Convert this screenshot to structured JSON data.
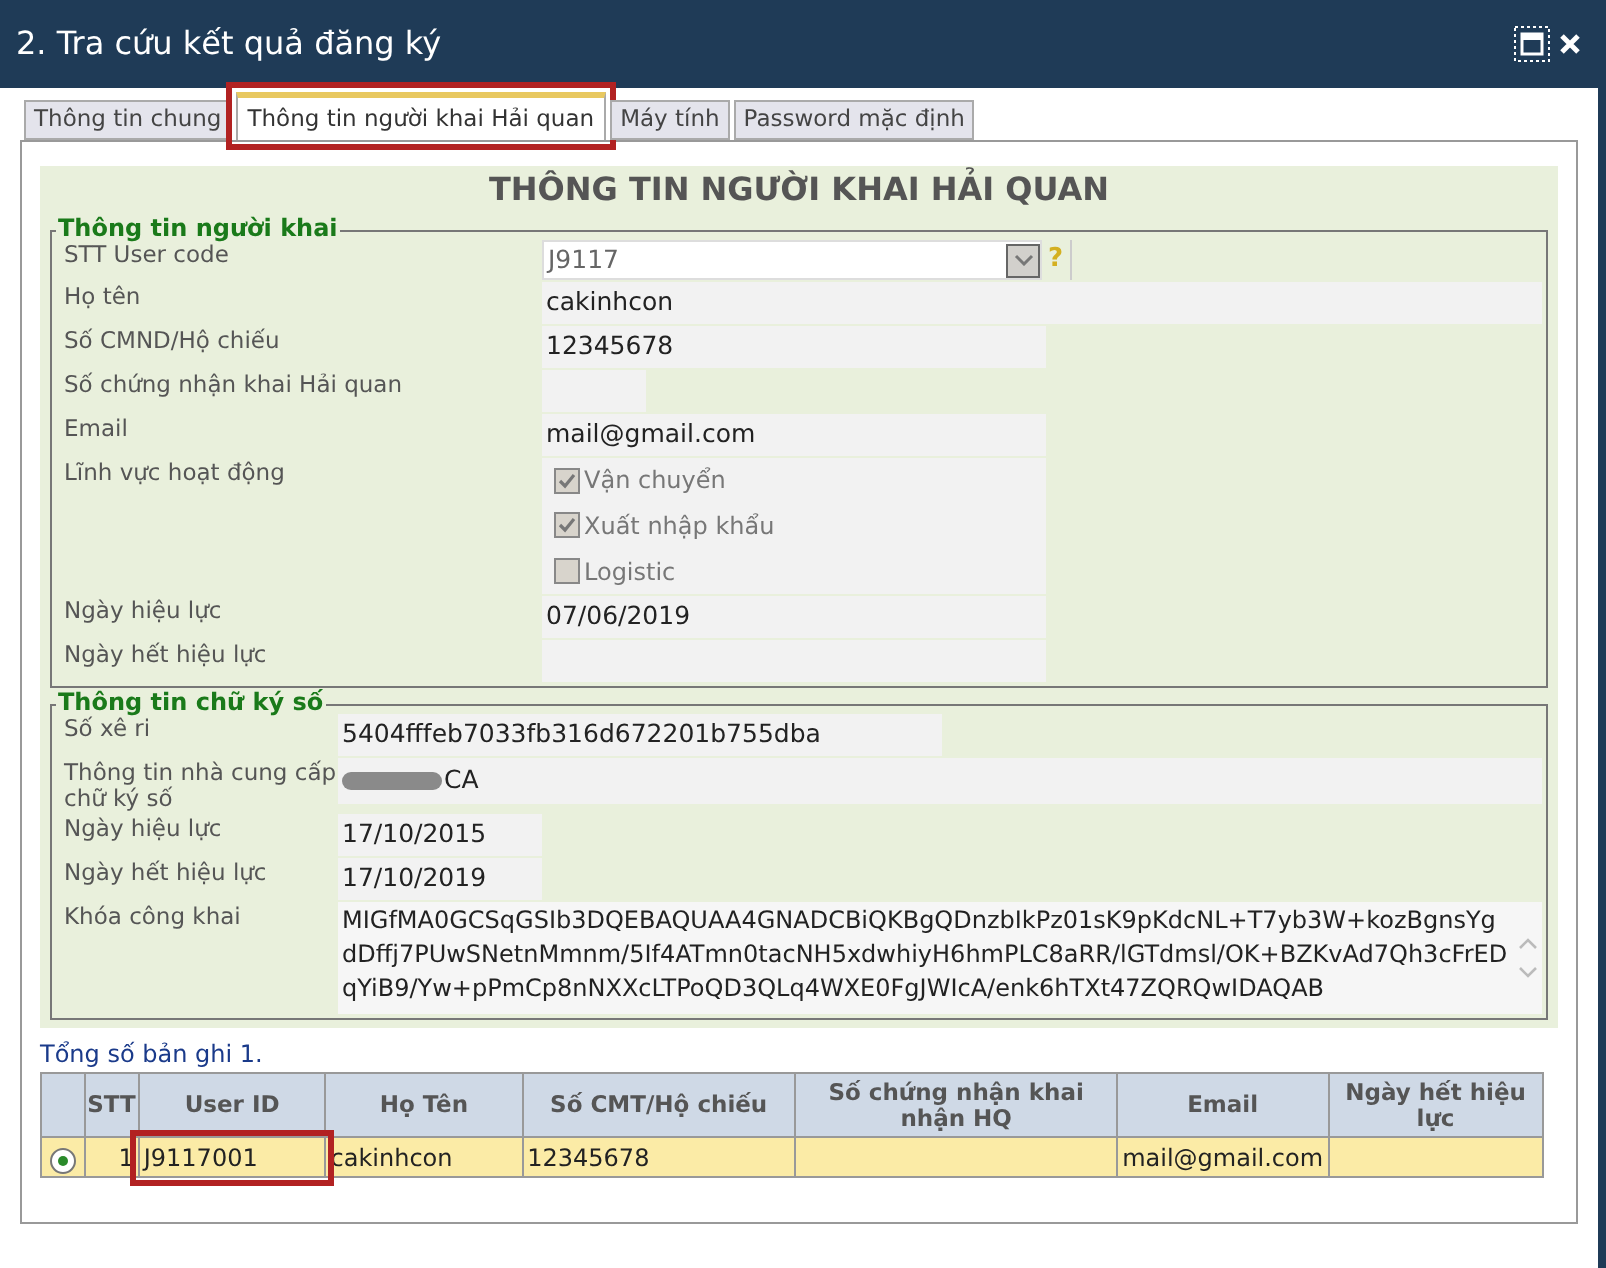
{
  "window": {
    "title": "2. Tra cứu kết quả đăng ký"
  },
  "tabs": [
    {
      "label": "Thông tin chung",
      "selected": false,
      "highlighted": false
    },
    {
      "label": "Thông tin người khai Hải quan",
      "selected": true,
      "highlighted": true
    },
    {
      "label": "Máy tính",
      "selected": false,
      "highlighted": false
    },
    {
      "label": "Password mặc định",
      "selected": false,
      "highlighted": false
    }
  ],
  "heading": "THÔNG TIN NGƯỜI KHAI HẢI QUAN",
  "declarant": {
    "legend": "Thông tin người khai",
    "fields": [
      {
        "kind": "combo",
        "label": "STT User code",
        "value": "J9117",
        "help": "?"
      },
      {
        "kind": "wide",
        "label": "Họ tên",
        "value": "cakinhcon"
      },
      {
        "kind": "medium",
        "label": "Số CMND/Hộ chiếu",
        "value": "12345678"
      },
      {
        "kind": "short",
        "label": "Số chứng nhận khai Hải quan"
      },
      {
        "kind": "medium",
        "label": "Email",
        "value": "mail@gmail.com"
      },
      {
        "kind": "checks",
        "label": "Lĩnh vực hoạt động",
        "options": [
          {
            "label": "Vận chuyển",
            "checked": true
          },
          {
            "label": "Xuất nhập khẩu",
            "checked": true
          },
          {
            "label": "Logistic",
            "checked": false
          }
        ]
      },
      {
        "kind": "medium",
        "label": "Ngày hiệu lực",
        "value": "07/06/2019"
      },
      {
        "kind": "medium",
        "label": "Ngày hết hiệu lực"
      }
    ]
  },
  "signature": {
    "legend": "Thông tin chữ ký số",
    "fields": [
      {
        "kind": "medium",
        "label": "Số xê ri",
        "value": "5404fffeb7033fb316d672201b755dba"
      },
      {
        "kind": "redacted",
        "label": "Thông tin nhà cung cấp chữ ký số",
        "value": "CA"
      },
      {
        "kind": "short",
        "label": "Ngày hiệu lực",
        "value": "17/10/2015"
      },
      {
        "kind": "short",
        "label": "Ngày hết hiệu lực",
        "value": "17/10/2019"
      },
      {
        "kind": "area",
        "label": "Khóa công khai",
        "value": "MIGfMA0GCSqGSIb3DQEBAQUAA4GNADCBiQKBgQDnzbIkPz01sK9pKdcNL+T7yb3W+kozBgnsYgdDffj7PUwSNetnMmnm/5If4ATmn0tacNH5xdwhiyH6hmPLC8aRR/lGTdmsl/OK+BZKvAd7Qh3cFrEDqYiB9/Yw+pPmCp8nNXXcLTPoQD3QLq4WXE0FgJWIcA/enk6hTXt47ZQRQwIDAQAB"
      }
    ]
  },
  "record_count": "Tổng số bản ghi 1.",
  "table": {
    "columns": [
      "STT",
      "User ID",
      "Họ Tên",
      "Số CMT/Hộ chiếu",
      "Số chứng nhận khai nhận HQ",
      "Email",
      "Ngày hết hiệu lực"
    ],
    "rows": [
      {
        "selected": true,
        "cells": [
          {
            "text": "1",
            "highlighted": false
          },
          {
            "text": "J9117001",
            "highlighted": true
          },
          {
            "text": "cakinhcon",
            "highlighted": false
          },
          {
            "text": "12345678",
            "highlighted": false
          },
          null,
          {
            "text": "mail@gmail.com",
            "highlighted": false
          },
          null
        ]
      }
    ]
  }
}
